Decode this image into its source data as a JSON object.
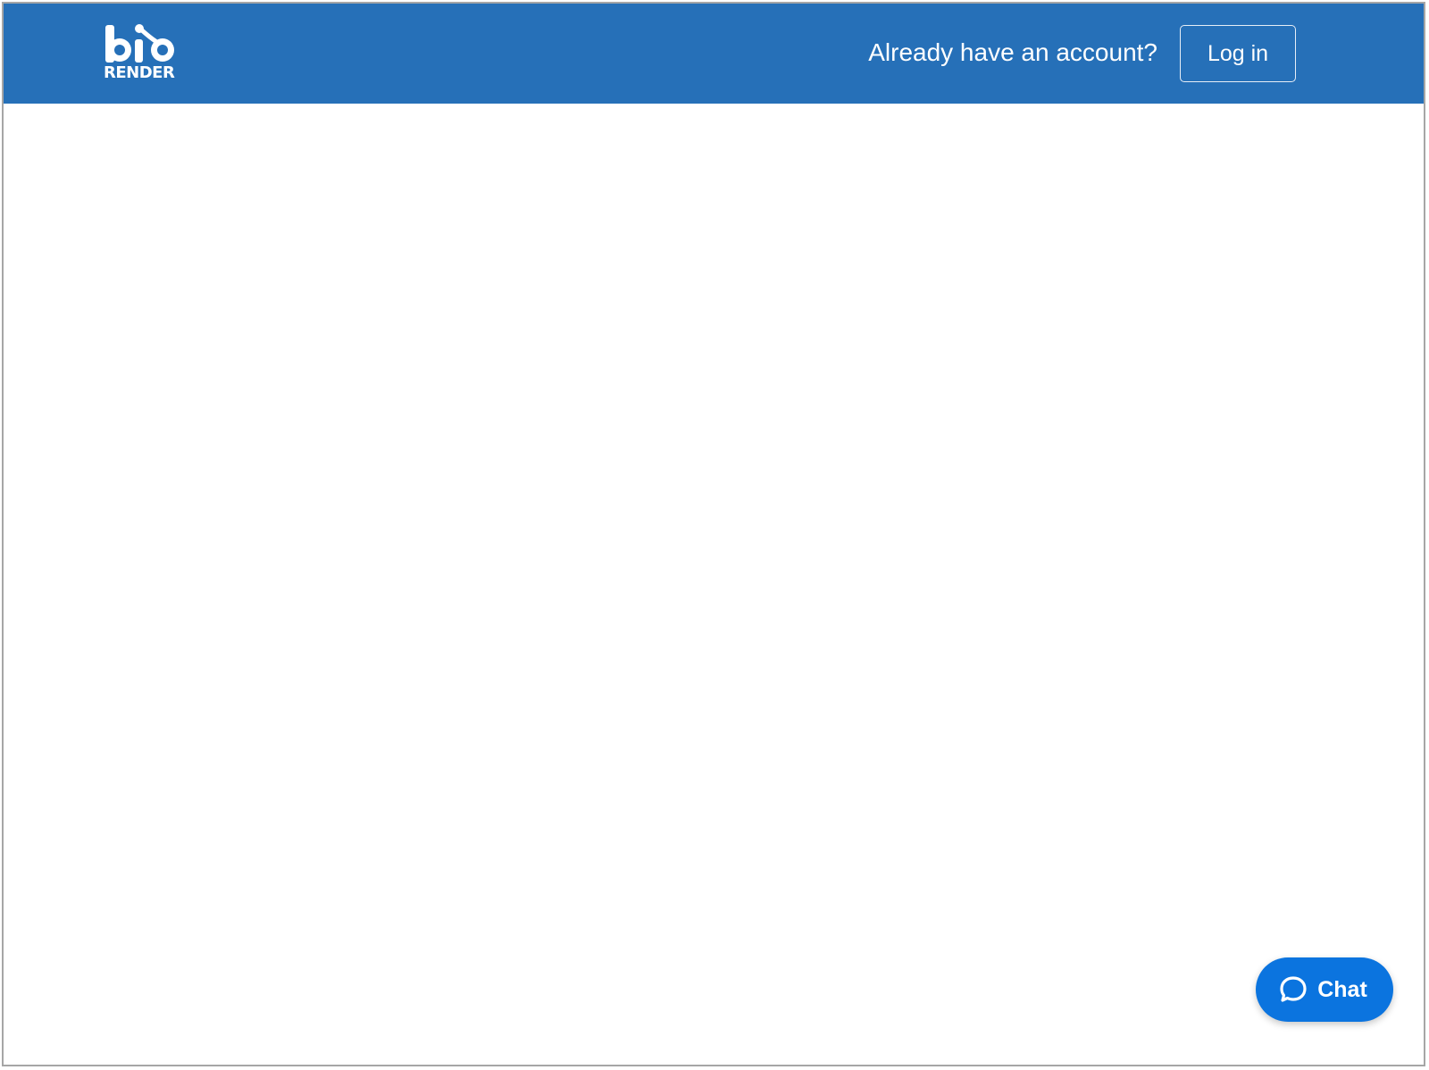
{
  "header": {
    "logo": {
      "mark_text": "bio",
      "word_text": "RENDER",
      "icon": "biorender-logo-icon"
    },
    "account_prompt": "Already have an account?",
    "login_label": "Log in"
  },
  "chat": {
    "label": "Chat",
    "icon": "chat-bubble-icon"
  },
  "colors": {
    "header_bg": "#2670b8",
    "chat_bg": "#0b74df",
    "page_bg": "#ffffff",
    "text_on_header": "#ffffff"
  }
}
